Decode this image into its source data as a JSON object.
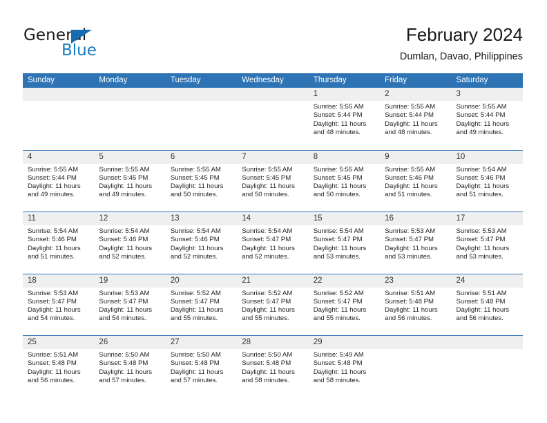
{
  "brand": {
    "name_part1": "General",
    "name_part2": "Blue",
    "flag_icon": "triangle-flag-icon"
  },
  "header": {
    "title": "February 2024",
    "subtitle": "Dumlan, Davao, Philippines"
  },
  "colors": {
    "header_blue": "#2e74b5",
    "brand_blue": "#1a7bc4",
    "day_band_gray": "#efefef"
  },
  "weekdays": [
    "Sunday",
    "Monday",
    "Tuesday",
    "Wednesday",
    "Thursday",
    "Friday",
    "Saturday"
  ],
  "weeks": [
    [
      {
        "day": "",
        "sunrise": "",
        "sunset": "",
        "daylight_line1": "",
        "daylight_line2": ""
      },
      {
        "day": "",
        "sunrise": "",
        "sunset": "",
        "daylight_line1": "",
        "daylight_line2": ""
      },
      {
        "day": "",
        "sunrise": "",
        "sunset": "",
        "daylight_line1": "",
        "daylight_line2": ""
      },
      {
        "day": "",
        "sunrise": "",
        "sunset": "",
        "daylight_line1": "",
        "daylight_line2": ""
      },
      {
        "day": "1",
        "sunrise": "Sunrise: 5:55 AM",
        "sunset": "Sunset: 5:44 PM",
        "daylight_line1": "Daylight: 11 hours",
        "daylight_line2": "and 48 minutes."
      },
      {
        "day": "2",
        "sunrise": "Sunrise: 5:55 AM",
        "sunset": "Sunset: 5:44 PM",
        "daylight_line1": "Daylight: 11 hours",
        "daylight_line2": "and 48 minutes."
      },
      {
        "day": "3",
        "sunrise": "Sunrise: 5:55 AM",
        "sunset": "Sunset: 5:44 PM",
        "daylight_line1": "Daylight: 11 hours",
        "daylight_line2": "and 49 minutes."
      }
    ],
    [
      {
        "day": "4",
        "sunrise": "Sunrise: 5:55 AM",
        "sunset": "Sunset: 5:44 PM",
        "daylight_line1": "Daylight: 11 hours",
        "daylight_line2": "and 49 minutes."
      },
      {
        "day": "5",
        "sunrise": "Sunrise: 5:55 AM",
        "sunset": "Sunset: 5:45 PM",
        "daylight_line1": "Daylight: 11 hours",
        "daylight_line2": "and 49 minutes."
      },
      {
        "day": "6",
        "sunrise": "Sunrise: 5:55 AM",
        "sunset": "Sunset: 5:45 PM",
        "daylight_line1": "Daylight: 11 hours",
        "daylight_line2": "and 50 minutes."
      },
      {
        "day": "7",
        "sunrise": "Sunrise: 5:55 AM",
        "sunset": "Sunset: 5:45 PM",
        "daylight_line1": "Daylight: 11 hours",
        "daylight_line2": "and 50 minutes."
      },
      {
        "day": "8",
        "sunrise": "Sunrise: 5:55 AM",
        "sunset": "Sunset: 5:45 PM",
        "daylight_line1": "Daylight: 11 hours",
        "daylight_line2": "and 50 minutes."
      },
      {
        "day": "9",
        "sunrise": "Sunrise: 5:55 AM",
        "sunset": "Sunset: 5:46 PM",
        "daylight_line1": "Daylight: 11 hours",
        "daylight_line2": "and 51 minutes."
      },
      {
        "day": "10",
        "sunrise": "Sunrise: 5:54 AM",
        "sunset": "Sunset: 5:46 PM",
        "daylight_line1": "Daylight: 11 hours",
        "daylight_line2": "and 51 minutes."
      }
    ],
    [
      {
        "day": "11",
        "sunrise": "Sunrise: 5:54 AM",
        "sunset": "Sunset: 5:46 PM",
        "daylight_line1": "Daylight: 11 hours",
        "daylight_line2": "and 51 minutes."
      },
      {
        "day": "12",
        "sunrise": "Sunrise: 5:54 AM",
        "sunset": "Sunset: 5:46 PM",
        "daylight_line1": "Daylight: 11 hours",
        "daylight_line2": "and 52 minutes."
      },
      {
        "day": "13",
        "sunrise": "Sunrise: 5:54 AM",
        "sunset": "Sunset: 5:46 PM",
        "daylight_line1": "Daylight: 11 hours",
        "daylight_line2": "and 52 minutes."
      },
      {
        "day": "14",
        "sunrise": "Sunrise: 5:54 AM",
        "sunset": "Sunset: 5:47 PM",
        "daylight_line1": "Daylight: 11 hours",
        "daylight_line2": "and 52 minutes."
      },
      {
        "day": "15",
        "sunrise": "Sunrise: 5:54 AM",
        "sunset": "Sunset: 5:47 PM",
        "daylight_line1": "Daylight: 11 hours",
        "daylight_line2": "and 53 minutes."
      },
      {
        "day": "16",
        "sunrise": "Sunrise: 5:53 AM",
        "sunset": "Sunset: 5:47 PM",
        "daylight_line1": "Daylight: 11 hours",
        "daylight_line2": "and 53 minutes."
      },
      {
        "day": "17",
        "sunrise": "Sunrise: 5:53 AM",
        "sunset": "Sunset: 5:47 PM",
        "daylight_line1": "Daylight: 11 hours",
        "daylight_line2": "and 53 minutes."
      }
    ],
    [
      {
        "day": "18",
        "sunrise": "Sunrise: 5:53 AM",
        "sunset": "Sunset: 5:47 PM",
        "daylight_line1": "Daylight: 11 hours",
        "daylight_line2": "and 54 minutes."
      },
      {
        "day": "19",
        "sunrise": "Sunrise: 5:53 AM",
        "sunset": "Sunset: 5:47 PM",
        "daylight_line1": "Daylight: 11 hours",
        "daylight_line2": "and 54 minutes."
      },
      {
        "day": "20",
        "sunrise": "Sunrise: 5:52 AM",
        "sunset": "Sunset: 5:47 PM",
        "daylight_line1": "Daylight: 11 hours",
        "daylight_line2": "and 55 minutes."
      },
      {
        "day": "21",
        "sunrise": "Sunrise: 5:52 AM",
        "sunset": "Sunset: 5:47 PM",
        "daylight_line1": "Daylight: 11 hours",
        "daylight_line2": "and 55 minutes."
      },
      {
        "day": "22",
        "sunrise": "Sunrise: 5:52 AM",
        "sunset": "Sunset: 5:47 PM",
        "daylight_line1": "Daylight: 11 hours",
        "daylight_line2": "and 55 minutes."
      },
      {
        "day": "23",
        "sunrise": "Sunrise: 5:51 AM",
        "sunset": "Sunset: 5:48 PM",
        "daylight_line1": "Daylight: 11 hours",
        "daylight_line2": "and 56 minutes."
      },
      {
        "day": "24",
        "sunrise": "Sunrise: 5:51 AM",
        "sunset": "Sunset: 5:48 PM",
        "daylight_line1": "Daylight: 11 hours",
        "daylight_line2": "and 56 minutes."
      }
    ],
    [
      {
        "day": "25",
        "sunrise": "Sunrise: 5:51 AM",
        "sunset": "Sunset: 5:48 PM",
        "daylight_line1": "Daylight: 11 hours",
        "daylight_line2": "and 56 minutes."
      },
      {
        "day": "26",
        "sunrise": "Sunrise: 5:50 AM",
        "sunset": "Sunset: 5:48 PM",
        "daylight_line1": "Daylight: 11 hours",
        "daylight_line2": "and 57 minutes."
      },
      {
        "day": "27",
        "sunrise": "Sunrise: 5:50 AM",
        "sunset": "Sunset: 5:48 PM",
        "daylight_line1": "Daylight: 11 hours",
        "daylight_line2": "and 57 minutes."
      },
      {
        "day": "28",
        "sunrise": "Sunrise: 5:50 AM",
        "sunset": "Sunset: 5:48 PM",
        "daylight_line1": "Daylight: 11 hours",
        "daylight_line2": "and 58 minutes."
      },
      {
        "day": "29",
        "sunrise": "Sunrise: 5:49 AM",
        "sunset": "Sunset: 5:48 PM",
        "daylight_line1": "Daylight: 11 hours",
        "daylight_line2": "and 58 minutes."
      },
      {
        "day": "",
        "sunrise": "",
        "sunset": "",
        "daylight_line1": "",
        "daylight_line2": ""
      },
      {
        "day": "",
        "sunrise": "",
        "sunset": "",
        "daylight_line1": "",
        "daylight_line2": ""
      }
    ]
  ]
}
